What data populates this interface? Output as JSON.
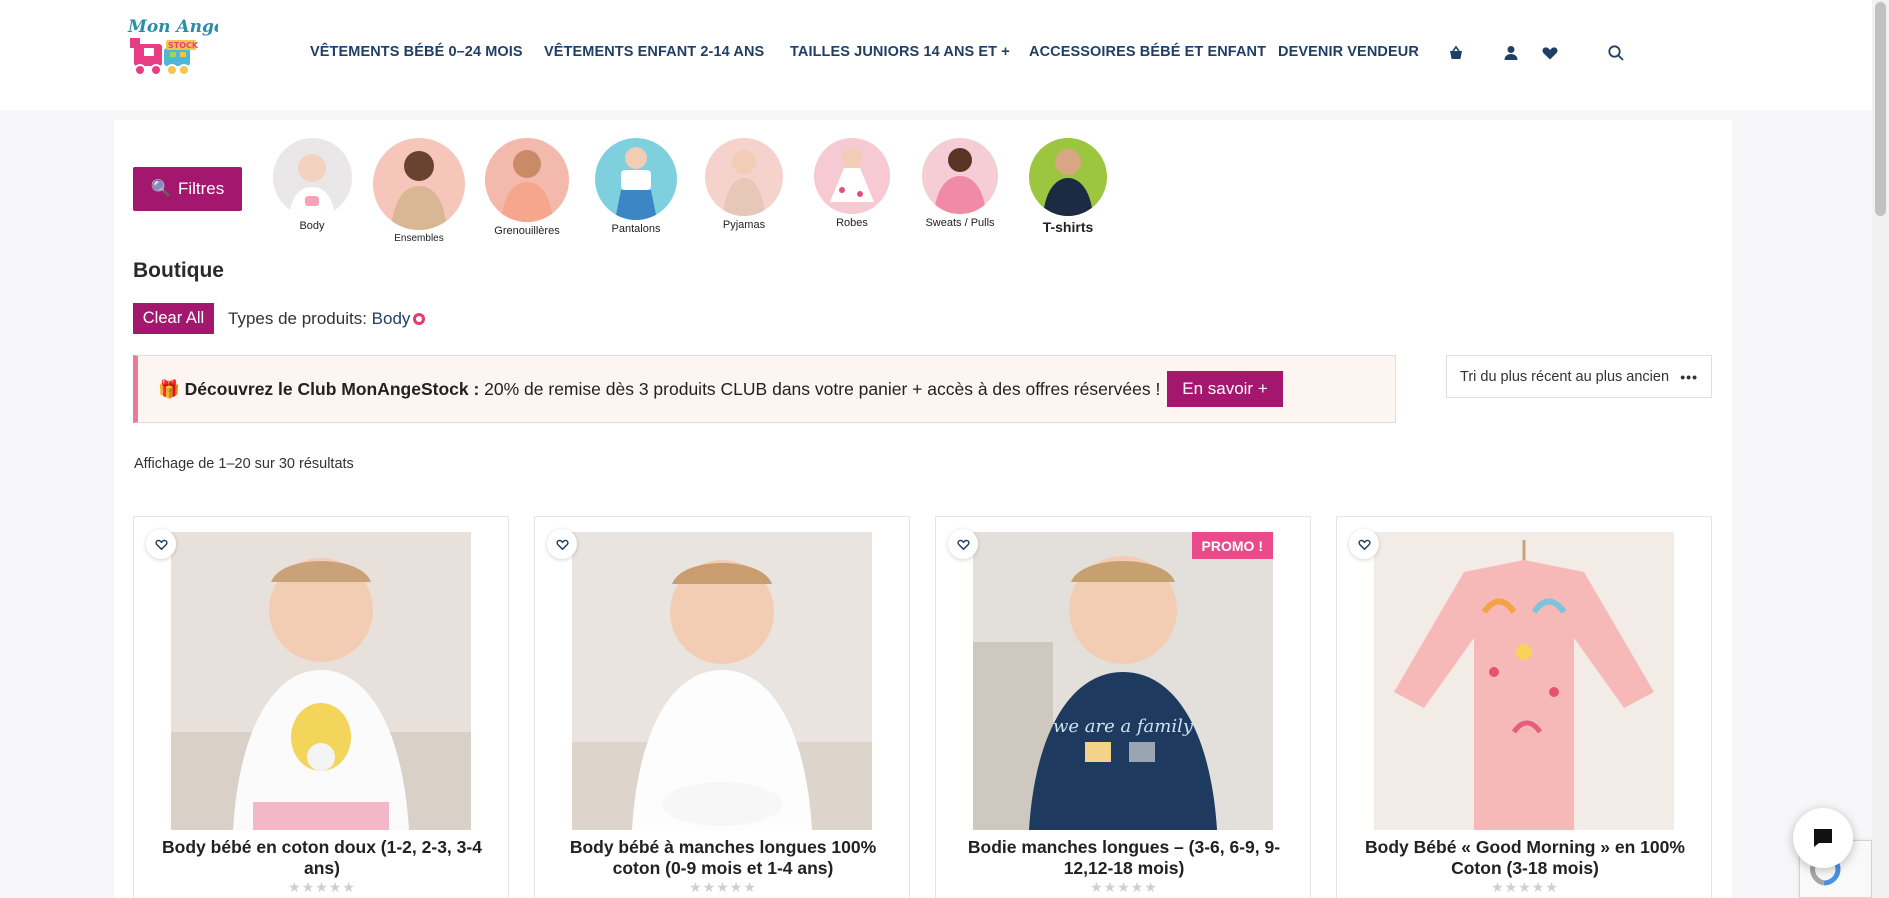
{
  "brand": {
    "name": "Mon Ange Stock",
    "logo_top": "Mon Ange",
    "logo_badge": "STOCK"
  },
  "nav": {
    "items": [
      {
        "label": "VÊTEMENTS BÉBÉ 0–24 MOIS"
      },
      {
        "label": "VÊTEMENTS ENFANT 2-14 ANS"
      },
      {
        "label": "TAILLES JUNIORS 14 ANS ET +"
      },
      {
        "label": "ACCESSOIRES BÉBÉ ET ENFANT"
      },
      {
        "label": "DEVENIR VENDEUR"
      }
    ],
    "icons": [
      "basket-icon",
      "user-icon",
      "heart-icon",
      "search-icon"
    ]
  },
  "filters_button": {
    "icon": "🔍",
    "label": "Filtres"
  },
  "categories": [
    {
      "label": "Body",
      "color": "#e9e7e7"
    },
    {
      "label": "Ensembles",
      "color": "#f6c6bb"
    },
    {
      "label": "Grenouillères",
      "color": "#f4b9ad"
    },
    {
      "label": "Pantalons",
      "color": "#7fd0df"
    },
    {
      "label": "Pyjamas",
      "color": "#f5d2cc"
    },
    {
      "label": "Robes",
      "color": "#f7c9d2"
    },
    {
      "label": "Sweats / Pulls",
      "color": "#f5cdd4"
    },
    {
      "label": "T-shirts",
      "color": "#9cc63f"
    }
  ],
  "page_title": "Boutique",
  "active_filters": {
    "clear_label": "Clear All",
    "type_label": "Types de produits:",
    "type_value": "Body"
  },
  "club_banner": {
    "icon": "🎁",
    "title": "Découvrez le Club MonAngeStock :",
    "text": " 20% de remise dès 3 produits CLUB dans votre panier + accès à des offres réservées !",
    "button": "En savoir +"
  },
  "sort": {
    "selected": "Tri du plus récent au plus ancien",
    "more": "•••"
  },
  "result_count": "Affichage de 1–20 sur 30 résultats",
  "products": [
    {
      "title": "Body bébé en coton doux (1-2, 2-3, 3-4 ans)",
      "badge": "",
      "rating": 0
    },
    {
      "title": "Body bébé à manches longues 100% coton (0-9 mois et 1-4 ans)",
      "badge": "",
      "rating": 0
    },
    {
      "title": "Bodie manches longues – (3-6, 6-9, 9-12,12-18 mois)",
      "badge": "PROMO !",
      "rating": 0
    },
    {
      "title": "Body Bébé « Good Morning » en 100% Coton (3-18 mois)",
      "badge": "",
      "rating": 0
    }
  ],
  "product_image_text": {
    "shirt_print": "we are a family"
  },
  "stars": "★★★★★",
  "colors": {
    "accent": "#a4176f",
    "nav": "#1f3f66",
    "promo": "#e84a8a",
    "club_border": "#e87a9c"
  }
}
